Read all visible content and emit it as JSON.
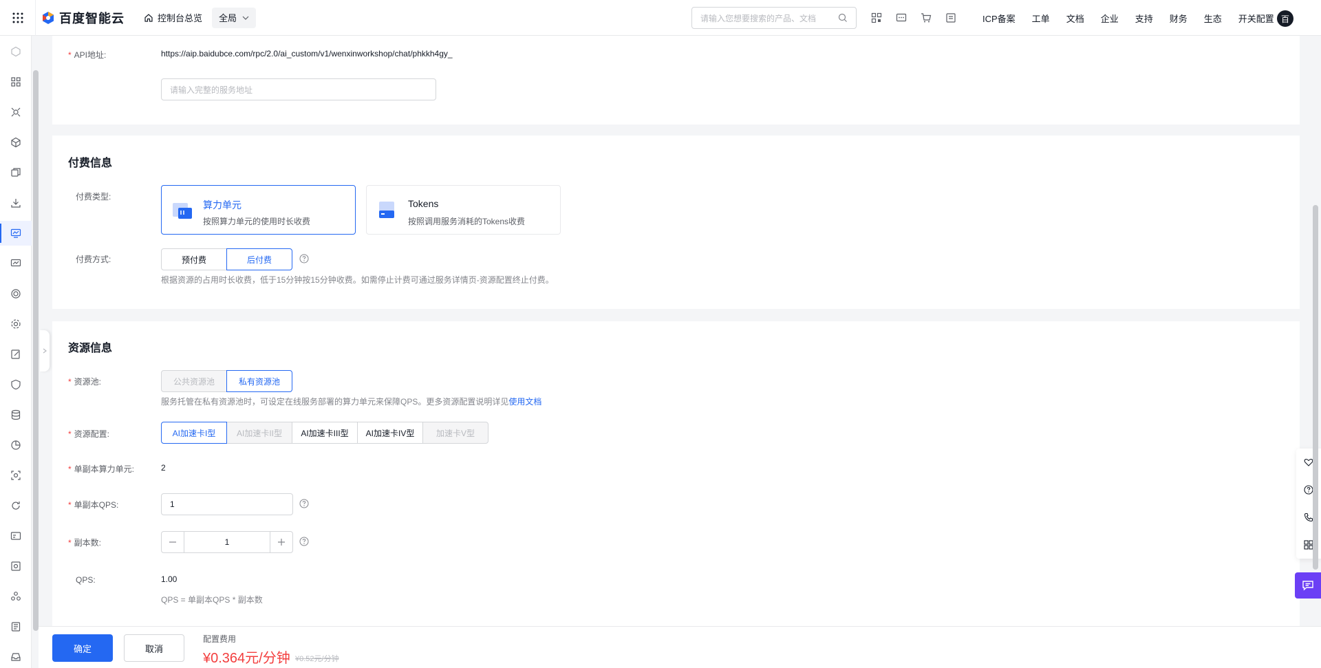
{
  "topbar": {
    "logo_text": "百度智能云",
    "console_link": "控制台总览",
    "scope": "全局",
    "search_placeholder": "请输入您想要搜索的产品、文档",
    "menu": [
      "ICP备案",
      "工单",
      "文档",
      "企业",
      "支持",
      "财务",
      "生态",
      "开关配置"
    ],
    "avatar_text": "百"
  },
  "api": {
    "label": "API地址:",
    "url": "https://aip.baidubce.com/rpc/2.0/ai_custom/v1/wenxinworkshop/chat/phkkh4gy_",
    "placeholder": "请输入完整的服务地址"
  },
  "billing": {
    "title": "付费信息",
    "type_label": "付费类型:",
    "cards": [
      {
        "title": "算力单元",
        "desc": "按照算力单元的使用时长收费"
      },
      {
        "title": "Tokens",
        "desc": "按照调用服务消耗的Tokens收费"
      }
    ],
    "method_label": "付费方式:",
    "methods": [
      "预付费",
      "后付费"
    ],
    "method_hint": "根据资源的占用时长收费，低于15分钟按15分钟收费。如需停止计费可通过服务详情页-资源配置终止付费。"
  },
  "resource": {
    "title": "资源信息",
    "pool_label": "资源池:",
    "pools": [
      "公共资源池",
      "私有资源池"
    ],
    "pool_hint": "服务托管在私有资源池时，可设定在线服务部署的算力单元来保障QPS。更多资源配置说明详见",
    "pool_hint_link": "使用文档",
    "config_label": "资源配置:",
    "configs": [
      "AI加速卡I型",
      "AI加速卡II型",
      "AI加速卡III型",
      "AI加速卡IV型",
      "加速卡V型"
    ],
    "unit_label": "单副本算力单元:",
    "unit_value": "2",
    "qps_per_label": "单副本QPS:",
    "qps_per_value": "1",
    "replicas_label": "副本数:",
    "replicas_value": "1",
    "qps_label": "QPS:",
    "qps_value": "1.00",
    "qps_formula": "QPS = 单副本QPS * 副本数"
  },
  "footer": {
    "confirm": "确定",
    "cancel": "取消",
    "fee_label": "配置费用",
    "price": "¥0.364元/分钟",
    "old_price": "¥0.52元/分钟"
  },
  "colors": {
    "accent": "#2468f2",
    "price": "#f33e3e",
    "chat": "#6b3ff5"
  }
}
